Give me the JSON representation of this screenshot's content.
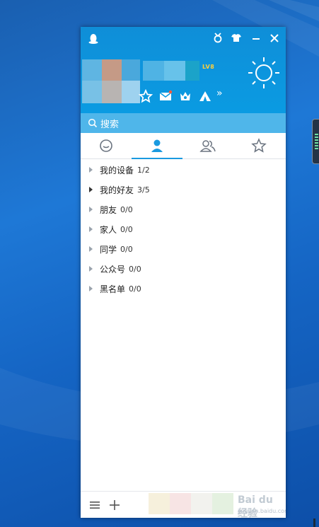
{
  "window": {
    "level_badge": "LV8",
    "search_placeholder": "搜索"
  },
  "contacts": {
    "groups": [
      {
        "name": "我的设备",
        "count": "1/2",
        "expanded": false
      },
      {
        "name": "我的好友",
        "count": "3/5",
        "expanded": false
      },
      {
        "name": "朋友",
        "count": "0/0",
        "expanded": false
      },
      {
        "name": "家人",
        "count": "0/0",
        "expanded": false
      },
      {
        "name": "同学",
        "count": "0/0",
        "expanded": false
      },
      {
        "name": "公众号",
        "count": "0/0",
        "expanded": false
      },
      {
        "name": "黑名单",
        "count": "0/0",
        "expanded": false
      }
    ]
  },
  "tabs": [
    {
      "id": "messages",
      "icon": "chat-bubble-icon"
    },
    {
      "id": "contacts",
      "icon": "person-icon",
      "active": true
    },
    {
      "id": "groups",
      "icon": "group-icon"
    },
    {
      "id": "favorites",
      "icon": "star-icon"
    }
  ],
  "watermark": {
    "brand": "Bai du 经验",
    "url": "jingyan.baidu.com"
  },
  "colors": {
    "header": "#0f8ed8",
    "search_bar": "#4fb6ea",
    "active_tab": "#1a9ae0"
  }
}
